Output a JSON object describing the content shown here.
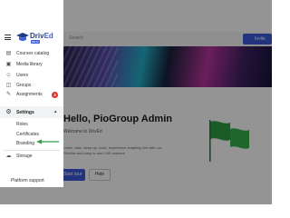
{
  "app": {
    "brand": "DrivEd",
    "brand_part_a": "Driv",
    "brand_part_b": "Ed",
    "brand_badge": "BETA"
  },
  "topbar": {
    "search_placeholder": "Search",
    "invite_label": "Invite"
  },
  "sidebar": {
    "items": [
      {
        "label": "Courses catalog",
        "icon": "book-icon"
      },
      {
        "label": "Media library",
        "icon": "media-icon"
      },
      {
        "label": "Users",
        "icon": "user-icon"
      },
      {
        "label": "Groups",
        "icon": "group-icon"
      },
      {
        "label": "Assignments",
        "icon": "assignment-icon",
        "badge": "3"
      }
    ],
    "settings": {
      "label": "Settings",
      "icon": "gear-icon",
      "expanded": true,
      "children": [
        {
          "label": "Roles"
        },
        {
          "label": "Certificates"
        },
        {
          "label": "Branding"
        }
      ]
    },
    "storage": {
      "label": "Storage",
      "icon": "storage-icon"
    },
    "support_label": "Platform support"
  },
  "main": {
    "greeting": "Hello, PioGroup Admin",
    "subtitle": "Welcome to DrivEd",
    "paragraph": "Learn, train, keep up, work, experience adapting rich with our. Flexible and easy to use LMS courses.",
    "primary_button": "Start tour",
    "secondary_button": "Hide"
  },
  "colors": {
    "accent": "#3b5bdb",
    "badge": "#e03131",
    "annotation_arrow": "#2f9e44",
    "overlay": "rgba(0,0,0,0.42)"
  }
}
